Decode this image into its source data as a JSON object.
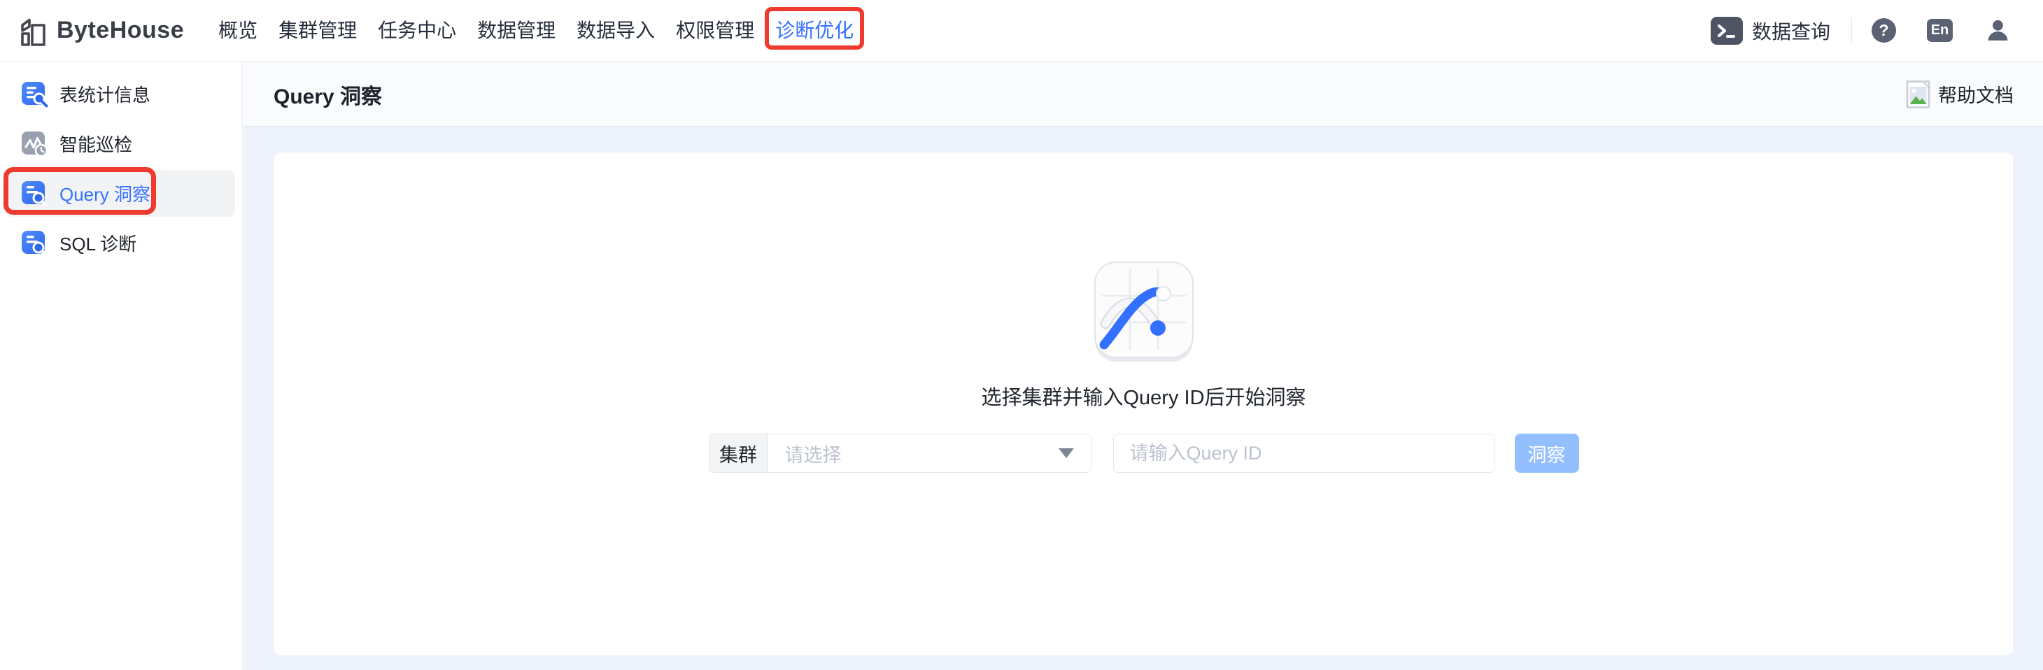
{
  "topnav": {
    "brand": "ByteHouse",
    "items": [
      {
        "label": "概览",
        "active": false
      },
      {
        "label": "集群管理",
        "active": false
      },
      {
        "label": "任务中心",
        "active": false
      },
      {
        "label": "数据管理",
        "active": false
      },
      {
        "label": "数据导入",
        "active": false
      },
      {
        "label": "权限管理",
        "active": false
      },
      {
        "label": "诊断优化",
        "active": true
      }
    ],
    "data_query_label": "数据查询",
    "help_icon_glyph": "?",
    "lang_badge_label": "En"
  },
  "sidebar": {
    "items": [
      {
        "label": "表统计信息",
        "icon": "table-stats-search-icon",
        "selected": false
      },
      {
        "label": "智能巡检",
        "icon": "inspection-trend-clock-icon",
        "selected": false
      },
      {
        "label": "Query 洞察",
        "icon": "query-insight-doc-search-icon",
        "selected": true
      },
      {
        "label": "SQL 诊断",
        "icon": "sql-diagnosis-doc-search-icon",
        "selected": false
      }
    ]
  },
  "page_header": {
    "title": "Query 洞察",
    "help_doc_label": "帮助文档",
    "help_doc_icon": "broken-image-icon"
  },
  "empty_state": {
    "icon": "line-chart-tile-icon",
    "hint": "选择集群并输入Query ID后开始洞察",
    "cluster_addon_label": "集群",
    "cluster_select_placeholder": "请选择",
    "query_id_placeholder": "请输入Query ID",
    "insight_button_label": "洞察"
  },
  "annotations": {
    "highlighted_nav_item": "诊断优化",
    "highlighted_sidebar_item": "Query 洞察",
    "color": "#ee3a2f"
  },
  "colors": {
    "accent_blue": "#3370ff",
    "annotation_red": "#ee3a2f",
    "disabled_button_blue": "#94bfff",
    "body_background": "#eef2fb",
    "icon_slate": "#5a6273"
  }
}
